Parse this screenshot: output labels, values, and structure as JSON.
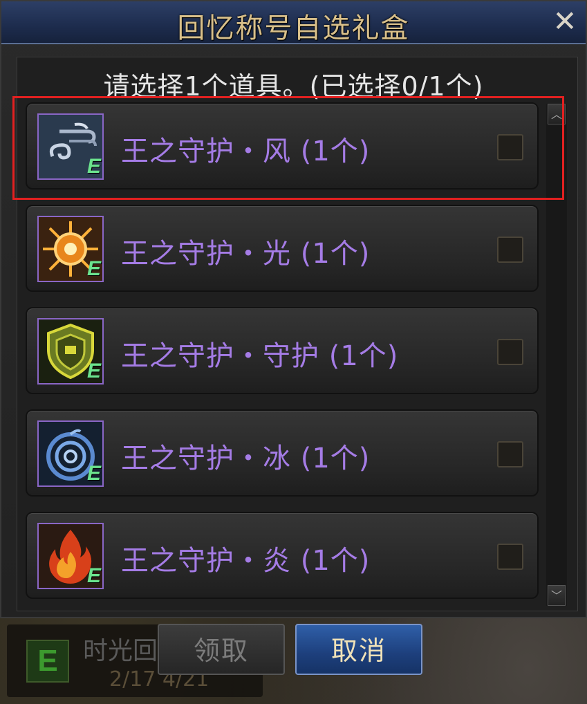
{
  "dialog": {
    "title": "回忆称号自选礼盒",
    "close_label": "✕",
    "prompt": "请选择1个道具。(已选择0/1个)"
  },
  "items": [
    {
      "label": "王之守护・风 (1个)",
      "icon": "wind-icon",
      "badge": "E",
      "checked": false
    },
    {
      "label": "王之守护・光 (1个)",
      "icon": "light-icon",
      "badge": "E",
      "checked": false
    },
    {
      "label": "王之守护・守护 (1个)",
      "icon": "shield-icon",
      "badge": "E",
      "checked": false
    },
    {
      "label": "王之守护・冰 (1个)",
      "icon": "ice-icon",
      "badge": "E",
      "checked": false
    },
    {
      "label": "王之守护・炎 (1个)",
      "icon": "flame-icon",
      "badge": "E",
      "checked": false
    }
  ],
  "buttons": {
    "claim_label": "领取",
    "cancel_label": "取消"
  },
  "background": {
    "item_badge": "E",
    "item_name": "时光回",
    "item_date": "2/17  4/21"
  },
  "colors": {
    "title": "#d9c08a",
    "item_label": "#a57ce6",
    "highlight": "#e32020",
    "e_badge": "#6be38e"
  }
}
